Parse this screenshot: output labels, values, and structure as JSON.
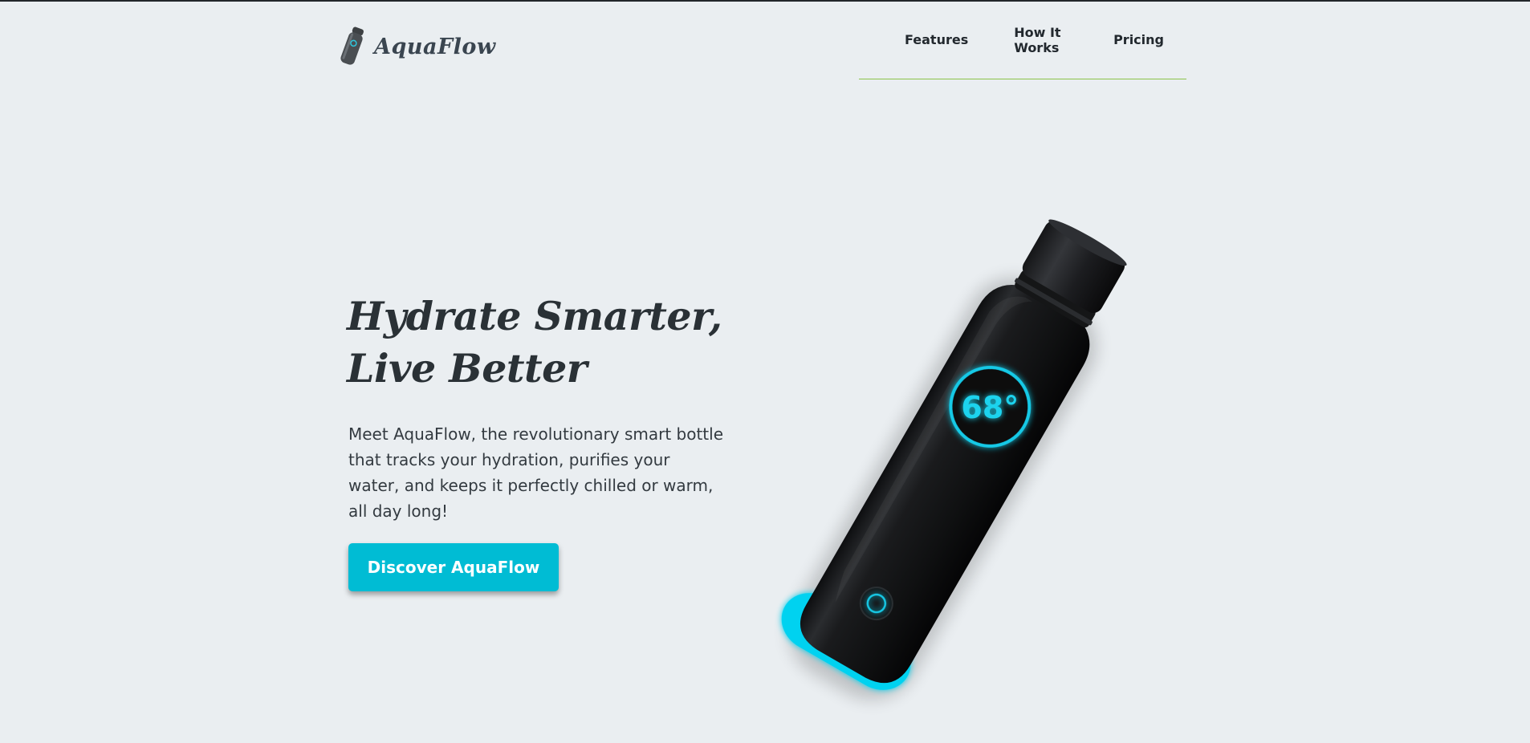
{
  "header": {
    "brand": "AquaFlow",
    "nav": [
      {
        "label": "Features"
      },
      {
        "label": "How It Works"
      },
      {
        "label": "Pricing"
      }
    ]
  },
  "hero": {
    "title_line1": "Hydrate Smarter,",
    "title_line2": "Live Better",
    "description": "Meet AquaFlow, the revolutionary smart bottle that tracks your hydration, purifies your water, and keeps it perfectly chilled or warm, all day long!",
    "cta_label": "Discover AquaFlow",
    "bottle_display": "68°"
  },
  "colors": {
    "background": "#eaeef1",
    "accent": "#00bcd4",
    "nav_underline": "#8bc34a",
    "text": "#2d3339"
  },
  "icons": {
    "logo": "bottle-icon",
    "product": "smart-bottle-image"
  }
}
